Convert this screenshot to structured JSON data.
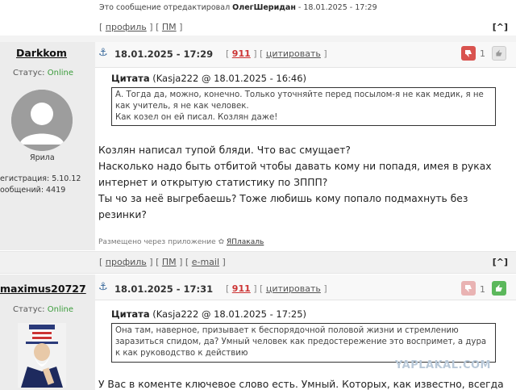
{
  "edited_note": {
    "prefix": "Это сообщение отредактировал ",
    "author": "ОлегШеридан",
    "suffix": " - 18.01.2025 - 17:29"
  },
  "post0_actions": {
    "open": "[",
    "profile": "профиль",
    "mid": "] [",
    "pm": "ПМ",
    "close": "]"
  },
  "up_button": "[^]",
  "post1": {
    "username": "Darkkom",
    "status_label": "Статус:",
    "status_value": "Online",
    "avatar_caption": "Ярила",
    "reg_line": "егистрация: 5.10.12",
    "msgs_line": "ообщений: 4419",
    "date": "18.01.2025 - 17:29",
    "num_open": "[",
    "number": "911",
    "num_mid": "] [",
    "quote_link": "цитировать",
    "num_close": "]",
    "votes": "1",
    "quote_title_label": "Цитата",
    "quote_title_meta": "(Kasja222 @ 18.01.2025 - 16:46)",
    "quote_text": "А. Тогда да, можно, конечно. Только уточняйте перед посылом-я не как медик, я не как учитель, я не как человек.\nКак козел он ей писал. Козлян даже!",
    "message_lines": [
      "Козлян написал тупой бляди. Что вас смущает?",
      "Насколько надо быть отбитой чтобы давать кому ни попадя, имея в руках",
      "интернет и открытую статистику по ЗППП?",
      "Ты чо за неё выгребаешь? Тоже любишь кому попало подмахнуть без",
      "резинки?"
    ],
    "via_prefix": "Размещено через приложение",
    "via_app": "ЯПлакаль",
    "actions": {
      "open": "[",
      "profile": "профиль",
      "m1": "] [",
      "pm": "ПМ",
      "m2": "] [",
      "email": "e-mail",
      "close": "]"
    }
  },
  "post2": {
    "username": "maximus20727",
    "status_label": "Статус:",
    "status_value": "Online",
    "date": "18.01.2025 - 17:31",
    "num_open": "[",
    "number": "911",
    "num_mid": "] [",
    "quote_link": "цитировать",
    "num_close": "]",
    "votes": "1",
    "quote_title_label": "Цитата",
    "quote_title_meta": "(Kasja222 @ 18.01.2025 - 17:25)",
    "quote_text": "Она там, наверное, призывает к беспорядочной половой жизни и стремлению заразиться спидом, да? Умный человек как предостережение это воспримет, а дура к как руководство к действию",
    "message_line": "У Вас в коменте ключевое слово есть. Умный. Которых, как известно, всегда"
  },
  "watermark": "YAPLAKAL.COM",
  "colors": {
    "online": "#3b9c3b",
    "post_number": "#cc3333",
    "minus_vote": "#d9534f",
    "plus_vote": "#5cb85c"
  }
}
